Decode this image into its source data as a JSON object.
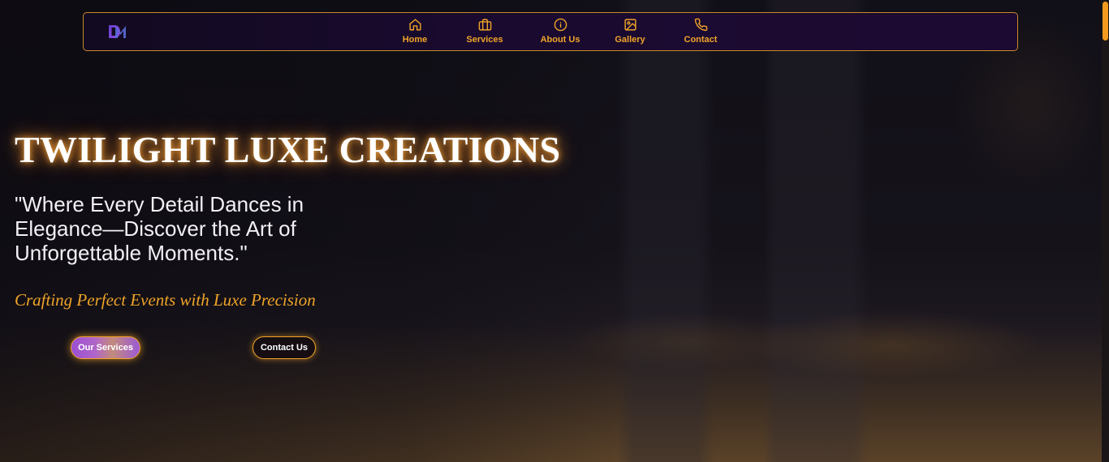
{
  "nav": {
    "logo_text": "DM",
    "items": [
      {
        "label": "Home",
        "icon": "home-icon"
      },
      {
        "label": "Services",
        "icon": "briefcase-icon"
      },
      {
        "label": "About Us",
        "icon": "info-icon"
      },
      {
        "label": "Gallery",
        "icon": "image-icon"
      },
      {
        "label": "Contact",
        "icon": "phone-icon"
      }
    ]
  },
  "hero": {
    "title": "TWILIGHT LUXE CREATIONS",
    "quote": "\"Where Every Detail Dances in Elegance—Discover the Art of Unforgettable Moments.\"",
    "tagline": "Crafting Perfect Events with Luxe Precision",
    "buttons": {
      "services_label": "Our Services",
      "contact_label": "Contact Us"
    }
  },
  "colors": {
    "accent": "#f0a428",
    "nav_bg": "#1a0a30",
    "button_gradient_start": "#9a4fd4",
    "button_gradient_end": "#c38a7c"
  }
}
